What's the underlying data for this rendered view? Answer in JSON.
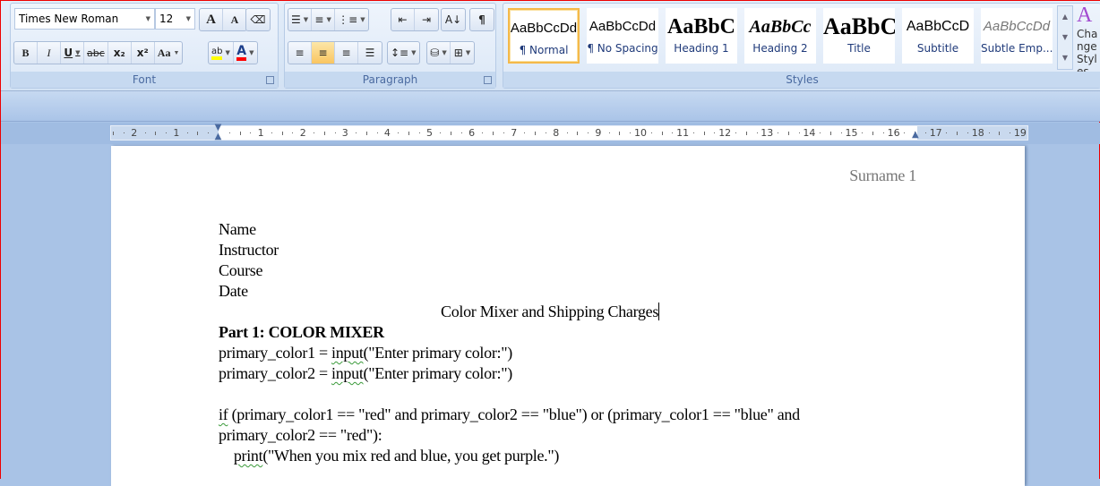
{
  "ribbon": {
    "font": {
      "label": "Font",
      "font_name": "Times New Roman",
      "font_size": "12",
      "buttons": [
        "A",
        "A",
        "B",
        "I",
        "U",
        "abc",
        "x₂",
        "x²",
        "Aa",
        "ab",
        "A"
      ],
      "highlight_color": "#ffff00",
      "font_color": "#ff0000"
    },
    "paragraph": {
      "label": "Paragraph",
      "pilcrow": "¶"
    },
    "styles": {
      "label": "Styles",
      "items": [
        {
          "preview": "AaBbCcDd",
          "name": "¶ Normal",
          "selected": true
        },
        {
          "preview": "AaBbCcDd",
          "name": "¶ No Spacing"
        },
        {
          "preview": "AaBbC",
          "name": "Heading 1"
        },
        {
          "preview": "AaBbCc",
          "name": "Heading 2"
        },
        {
          "preview": "AaBbC",
          "name": "Title"
        },
        {
          "preview": "AaBbCcD",
          "name": "Subtitle"
        },
        {
          "preview": "AaBbCcDd",
          "name": "Subtle Emp..."
        }
      ],
      "change_styles": "Change Styles"
    }
  },
  "ruler": {
    "left_labels": [
      "2",
      "1"
    ],
    "labels": [
      "1",
      "2",
      "3",
      "4",
      "5",
      "6",
      "7",
      "8",
      "9",
      "10",
      "11",
      "12",
      "13",
      "14",
      "15",
      "16",
      "17",
      "18",
      "19"
    ]
  },
  "document": {
    "header": "Surname 1",
    "lines": [
      "Name",
      "Instructor",
      "Course",
      "Date"
    ],
    "title": "Color Mixer and Shipping Charges",
    "part_heading": "Part 1: COLOR MIXER",
    "code": [
      {
        "pre": "primary_color1 = ",
        "sq": "input",
        "post": "(\"Enter primary color:\")"
      },
      {
        "pre": "primary_color2 = ",
        "sq": "input",
        "post": "(\"Enter primary color:\")"
      },
      {
        "pre": "",
        "sq": "if",
        "post": " (primary_color1 == \"red\" and primary_color2 == \"blue\") or (primary_color1 == \"blue\" and"
      },
      {
        "pre": "primary_color2 == \"red\"):",
        "sq": "",
        "post": ""
      },
      {
        "pre": "    ",
        "sq": "print",
        "post": "(\"When you mix red and blue, you get purple.\")"
      }
    ]
  }
}
